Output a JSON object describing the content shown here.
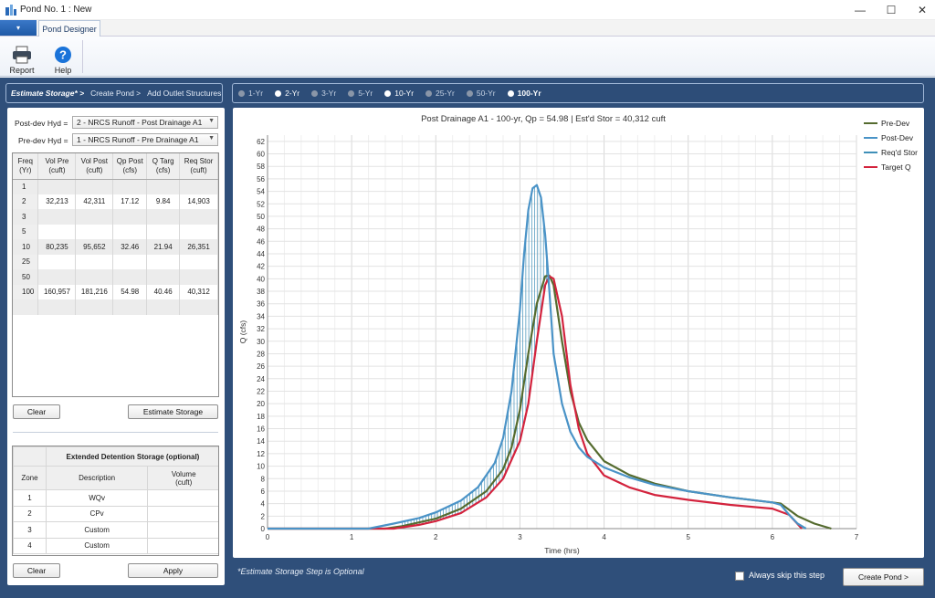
{
  "window": {
    "title": "Pond No. 1 : New",
    "controls": {
      "minimize": "—",
      "maximize": "☐",
      "close": "✕"
    }
  },
  "ribbon": {
    "menu_glyph": "▾",
    "tab_label": "Pond Designer",
    "buttons": [
      {
        "label": "Report",
        "icon": "printer-icon"
      },
      {
        "label": "Help",
        "icon": "help-icon"
      }
    ]
  },
  "steps": {
    "items": [
      "Estimate Storage* >",
      "Create Pond >",
      "Add Outlet Structures"
    ],
    "active": 0
  },
  "frequencies": {
    "items": [
      {
        "label": "1-Yr",
        "enabled": false
      },
      {
        "label": "2-Yr",
        "enabled": true
      },
      {
        "label": "3-Yr",
        "enabled": false
      },
      {
        "label": "5-Yr",
        "enabled": false
      },
      {
        "label": "10-Yr",
        "enabled": true
      },
      {
        "label": "25-Yr",
        "enabled": false
      },
      {
        "label": "50-Yr",
        "enabled": false
      },
      {
        "label": "100-Yr",
        "enabled": true
      }
    ],
    "selected": "100-Yr"
  },
  "hydrographs": {
    "post_label": "Post-dev Hyd =",
    "post_value": "2 - NRCS Runoff - Post Drainage A1",
    "pre_label": "Pre-dev Hyd =",
    "pre_value": "1 - NRCS Runoff - Pre Drainage A1"
  },
  "freq_table": {
    "headers": [
      "Freq\n(Yr)",
      "Vol Pre\n(cuft)",
      "Vol Post\n(cuft)",
      "Qp Post\n(cfs)",
      "Q Targ\n(cfs)",
      "Req Stor\n(cuft)"
    ],
    "rows": [
      [
        "1",
        "",
        "",
        "",
        "",
        ""
      ],
      [
        "2",
        "32,213",
        "42,311",
        "17.12",
        "9.84",
        "14,903"
      ],
      [
        "3",
        "",
        "",
        "",
        "",
        ""
      ],
      [
        "5",
        "",
        "",
        "",
        "",
        ""
      ],
      [
        "10",
        "80,235",
        "95,652",
        "32.46",
        "21.94",
        "26,351"
      ],
      [
        "25",
        "",
        "",
        "",
        "",
        ""
      ],
      [
        "50",
        "",
        "",
        "",
        "",
        ""
      ],
      [
        "100",
        "160,957",
        "181,216",
        "54.98",
        "40.46",
        "40,312"
      ],
      [
        "",
        "",
        "",
        "",
        "",
        ""
      ]
    ]
  },
  "buttons": {
    "clear": "Clear",
    "estimate": "Estimate Storage",
    "clear2": "Clear",
    "apply": "Apply",
    "create_pond": "Create Pond >"
  },
  "ed_table": {
    "title": "Extended Detention Storage (optional)",
    "headers": [
      "Zone",
      "Description",
      "Volume\n(cuft)"
    ],
    "rows": [
      [
        "1",
        "WQv",
        ""
      ],
      [
        "2",
        "CPv",
        ""
      ],
      [
        "3",
        "Custom",
        ""
      ],
      [
        "4",
        "Custom",
        ""
      ]
    ]
  },
  "footer": {
    "note": "*Estimate Storage Step is Optional",
    "skip_label": "Always skip this step"
  },
  "colors": {
    "pre": "#556b2f",
    "post": "#4a93c7",
    "reqd": "#3f8fb8",
    "target": "#d3233d"
  },
  "chart_data": {
    "type": "line",
    "title": "Post Drainage A1 - 100-yr, Qp = 54.98 | Est'd Stor = 40,312 cuft",
    "xlabel": "Time (hrs)",
    "ylabel": "Q (cfs)",
    "xlim": [
      0,
      7
    ],
    "ylim": [
      0,
      63
    ],
    "xticks": [
      0,
      1,
      2,
      3,
      4,
      5,
      6,
      7
    ],
    "yticks": [
      0,
      2,
      4,
      6,
      8,
      10,
      12,
      14,
      16,
      18,
      20,
      22,
      24,
      26,
      28,
      30,
      32,
      34,
      36,
      38,
      40,
      42,
      44,
      46,
      48,
      50,
      52,
      54,
      56,
      58,
      60,
      62
    ],
    "grid": true,
    "legend_position": "right",
    "series": [
      {
        "name": "Pre-Dev",
        "x": [
          0,
          1.4,
          1.6,
          2.0,
          2.3,
          2.6,
          2.8,
          2.9,
          3.0,
          3.1,
          3.2,
          3.3,
          3.35,
          3.4,
          3.5,
          3.6,
          3.7,
          3.8,
          4.0,
          4.3,
          4.6,
          5.0,
          5.5,
          6.0,
          6.1,
          6.3,
          6.5,
          6.7
        ],
        "y": [
          0,
          0,
          0.4,
          1.6,
          3.2,
          6.0,
          9.5,
          13,
          19,
          28,
          36,
          40.4,
          40.5,
          39,
          30,
          22,
          17,
          14.2,
          10.8,
          8.6,
          7.2,
          6.0,
          5.0,
          4.2,
          4.0,
          2.0,
          0.8,
          0
        ]
      },
      {
        "name": "Post-Dev",
        "x": [
          0,
          1.2,
          1.5,
          1.8,
          2.0,
          2.3,
          2.5,
          2.7,
          2.8,
          2.9,
          3.0,
          3.05,
          3.1,
          3.15,
          3.2,
          3.25,
          3.3,
          3.35,
          3.4,
          3.5,
          3.6,
          3.7,
          3.8,
          4.0,
          4.3,
          4.6,
          5.0,
          5.5,
          6.0,
          6.1,
          6.2,
          6.3,
          6.4
        ],
        "y": [
          0,
          0,
          0.8,
          1.7,
          2.6,
          4.5,
          6.6,
          10.5,
          14.5,
          22,
          35,
          44,
          51,
          54.5,
          55,
          53,
          47,
          38,
          28,
          20,
          15.5,
          13.0,
          11.5,
          9.8,
          8.2,
          7.0,
          6.0,
          5.0,
          4.2,
          3.8,
          2.2,
          0.8,
          0
        ]
      },
      {
        "name": "Req'd Stor",
        "x": [],
        "y": []
      },
      {
        "name": "Target Q",
        "x": [
          0,
          1.5,
          1.8,
          2.0,
          2.3,
          2.6,
          2.8,
          3.0,
          3.1,
          3.2,
          3.3,
          3.35,
          3.4,
          3.5,
          3.6,
          3.7,
          3.8,
          4.0,
          4.3,
          4.6,
          5.0,
          5.5,
          6.0,
          6.2,
          6.35
        ],
        "y": [
          0,
          0,
          0.6,
          1.2,
          2.5,
          5,
          8,
          14,
          20,
          30,
          39,
          40.4,
          40,
          34,
          23,
          16,
          12,
          8.5,
          6.6,
          5.4,
          4.6,
          3.8,
          3.2,
          2.2,
          0
        ]
      }
    ]
  }
}
